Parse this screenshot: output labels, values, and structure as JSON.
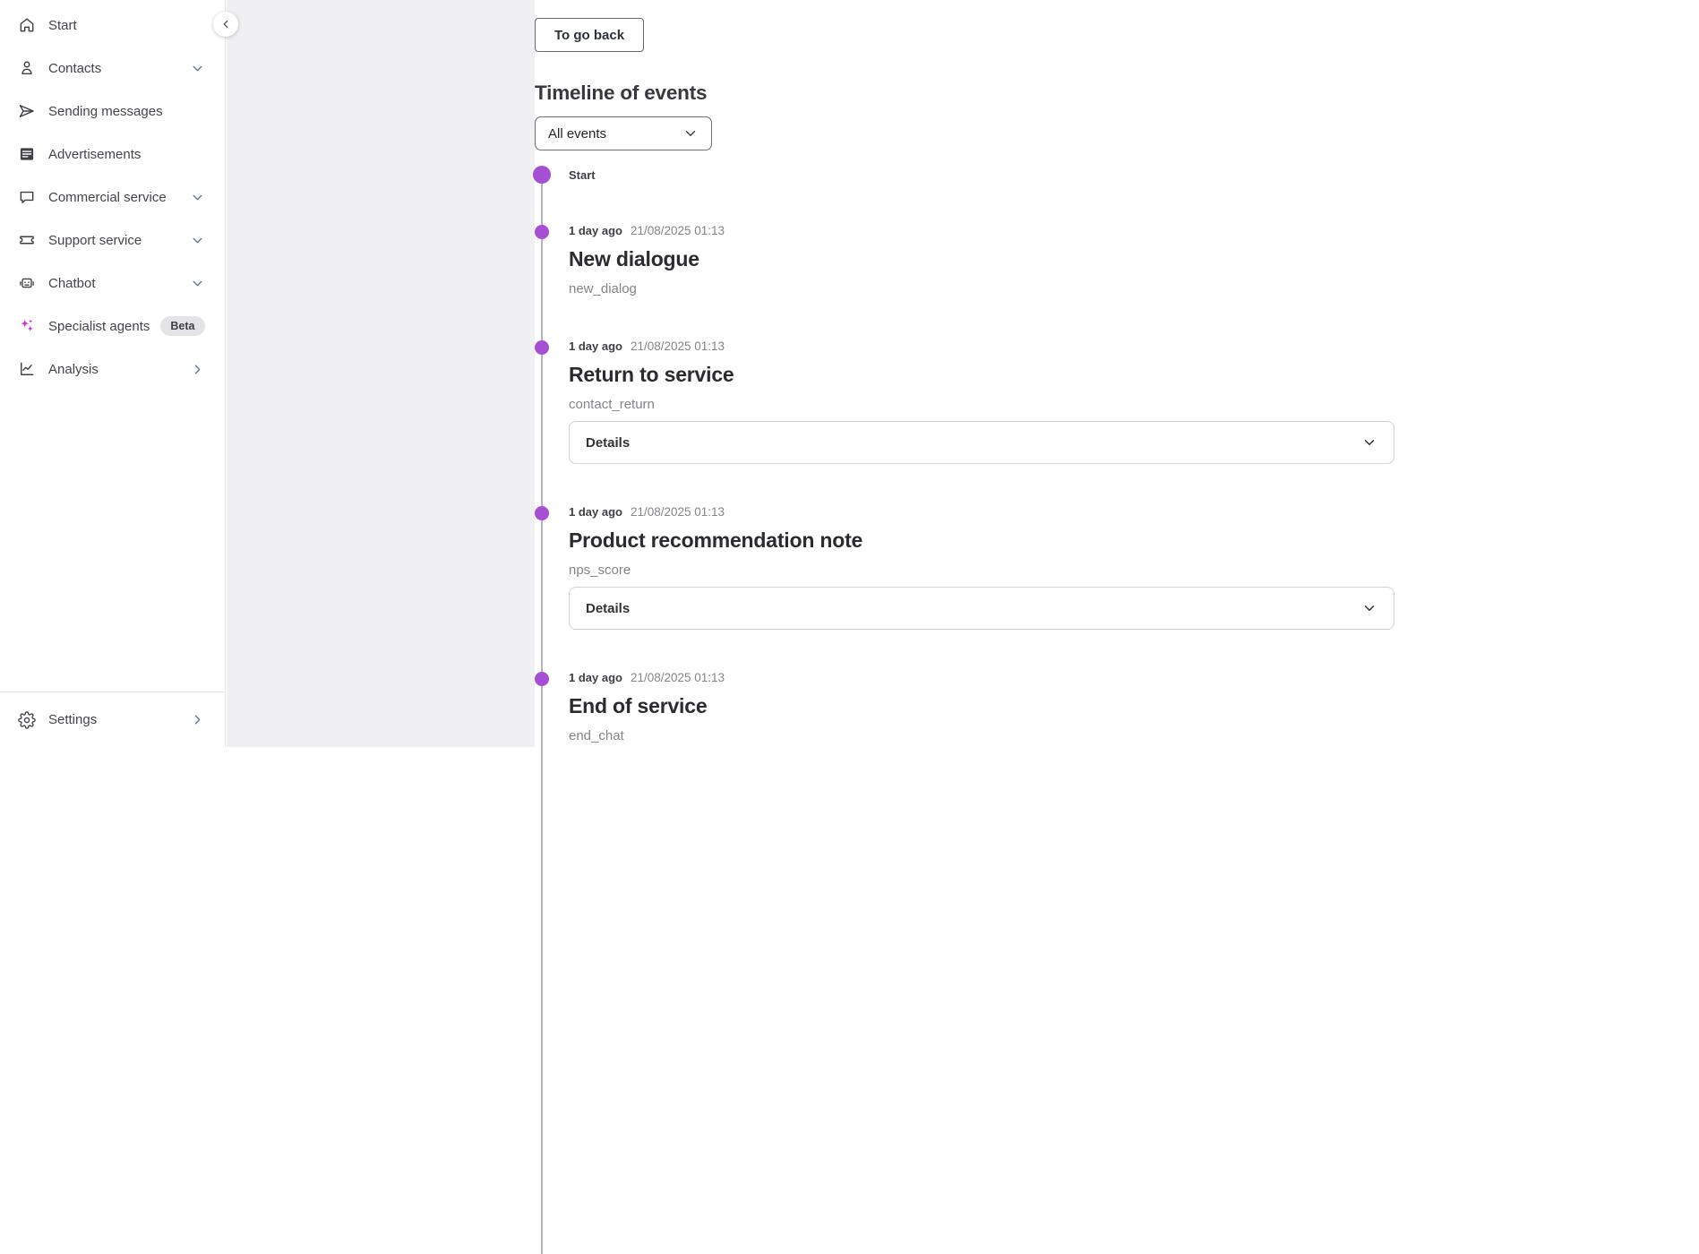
{
  "colors": {
    "accent_purple": "#A54FD2",
    "sparkle_magenta": "#C63FD2",
    "panel_gray": "#F0F0F2"
  },
  "sidebar": {
    "items": [
      {
        "label": "Start",
        "icon": "home-icon"
      },
      {
        "label": "Contacts",
        "icon": "person-icon",
        "chevron": "down"
      },
      {
        "label": "Sending messages",
        "icon": "send-icon"
      },
      {
        "label": "Advertisements",
        "icon": "ads-icon"
      },
      {
        "label": "Commercial service",
        "icon": "chat-bubble-icon",
        "chevron": "down"
      },
      {
        "label": "Support service",
        "icon": "ticket-icon",
        "chevron": "down"
      },
      {
        "label": "Chatbot",
        "icon": "robot-icon",
        "chevron": "down"
      },
      {
        "label": "Specialist agents",
        "icon": "sparkles-icon",
        "badge": "Beta"
      },
      {
        "label": "Analysis",
        "icon": "line-chart-icon",
        "chevron": "right"
      }
    ],
    "footer": {
      "label": "Settings",
      "icon": "gear-icon",
      "chevron": "right"
    }
  },
  "main": {
    "back_button_label": "To go back",
    "page_title": "Timeline of events",
    "event_filter": {
      "value": "All events"
    },
    "details_label": "Details",
    "timeline": [
      {
        "type": "start",
        "label": "Start"
      },
      {
        "type": "event",
        "relative_time": "1 day ago",
        "timestamp": "21/08/2025 01:13",
        "title": "New dialogue",
        "event_code": "new_dialog",
        "has_details": false
      },
      {
        "type": "event",
        "relative_time": "1 day ago",
        "timestamp": "21/08/2025 01:13",
        "title": "Return to service",
        "event_code": "contact_return",
        "has_details": true
      },
      {
        "type": "event",
        "relative_time": "1 day ago",
        "timestamp": "21/08/2025 01:13",
        "title": "Product recommendation note",
        "event_code": "nps_score",
        "has_details": true
      },
      {
        "type": "event",
        "relative_time": "1 day ago",
        "timestamp": "21/08/2025 01:13",
        "title": "End of service",
        "event_code": "end_chat",
        "has_details": false
      }
    ]
  }
}
